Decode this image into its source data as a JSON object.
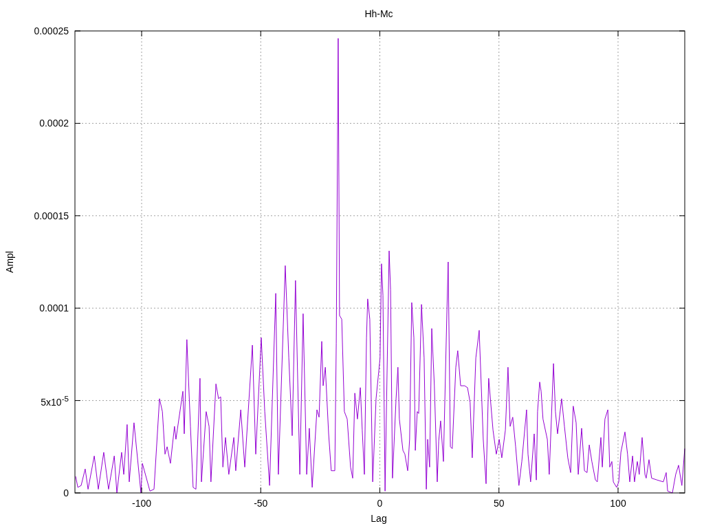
{
  "chart_data": {
    "type": "line",
    "grid": true,
    "title": "Hh-Mc",
    "xlabel": "Lag",
    "ylabel": "Ampl",
    "xlim": [
      -128,
      128
    ],
    "ylim": [
      0,
      0.00025
    ],
    "xticks": [
      -100,
      -50,
      0,
      50,
      100
    ],
    "yticks": [
      0,
      {
        "value": 5e-05,
        "label": "5x10$^{-5}$"
      },
      0.0001,
      0.00015,
      0.0002,
      0.00025
    ],
    "x": [
      -127.7,
      -126.8,
      -125.4,
      -123.7,
      -122.5,
      -119.9,
      -118.2,
      -115.9,
      -113.9,
      -111.5,
      -110.4,
      -108.4,
      -107.5,
      -106.1,
      -105.2,
      -103.2,
      -100.3,
      -99.7,
      -96.5,
      -94.8,
      -92.5,
      -91.3,
      -90.2,
      -89.3,
      -87.9,
      -86.2,
      -85.6,
      -82.7,
      -82.1,
      -81.0,
      -79.5,
      -78.4,
      -77.2,
      -75.5,
      -74.9,
      -72.9,
      -71.7,
      -70.9,
      -68.8,
      -67.7,
      -66.8,
      -65.9,
      -64.8,
      -63.4,
      -61.3,
      -60.5,
      -58.4,
      -56.7,
      -53.5,
      -52.1,
      -49.8,
      -48.3,
      -46.3,
      -43.7,
      -42.6,
      -39.7,
      -38.2,
      -36.8,
      -35.4,
      -33.6,
      -32.2,
      -30.7,
      -29.6,
      -28.4,
      -26.4,
      -25.5,
      -24.4,
      -23.8,
      -22.9,
      -21.5,
      -20.4,
      -18.9,
      -18.3,
      -17.5,
      -16.9,
      -16.0,
      -14.9,
      -13.7,
      -12.3,
      -11.4,
      -10.5,
      -9.4,
      -8.2,
      -7.4,
      -6.5,
      -5.6,
      -5.1,
      -4.2,
      -3.0,
      -1.6,
      0.1,
      0.7,
      1.3,
      2.2,
      3.9,
      4.5,
      5.3,
      6.8,
      7.6,
      8.2,
      9.7,
      10.5,
      11.7,
      12.5,
      13.4,
      14.3,
      14.9,
      15.7,
      16.3,
      17.5,
      18.6,
      19.5,
      20.1,
      20.9,
      21.8,
      22.9,
      24.1,
      24.7,
      25.5,
      26.7,
      28.1,
      28.7,
      29.6,
      30.4,
      31.9,
      32.7,
      33.9,
      35.6,
      36.8,
      37.9,
      38.8,
      40.3,
      41.7,
      43.4,
      44.6,
      45.7,
      47.5,
      48.9,
      50.1,
      51.2,
      52.7,
      53.8,
      54.7,
      55.8,
      57.0,
      58.4,
      59.6,
      61.6,
      62.2,
      63.3,
      64.8,
      65.7,
      66.2,
      67.1,
      67.7,
      68.5,
      70.3,
      71.1,
      72.9,
      73.7,
      74.6,
      76.3,
      77.5,
      78.9,
      80.1,
      81.2,
      82.4,
      83.3,
      84.7,
      85.9,
      87.0,
      87.9,
      89.0,
      90.5,
      91.3,
      92.8,
      93.4,
      94.5,
      95.7,
      96.5,
      97.4,
      98.0,
      99.4,
      100.3,
      101.2,
      102.9,
      104.0,
      104.9,
      106.1,
      106.9,
      108.1,
      108.9,
      110.1,
      111.3,
      111.8,
      113.0,
      114.1,
      116.4,
      119.0,
      120.2,
      120.8,
      122.8,
      124.2,
      125.4,
      126.8,
      128.0
    ],
    "series": [
      {
        "color": "#9400d3",
        "values": [
          9e-06,
          3e-06,
          4e-06,
          1.3e-05,
          2e-06,
          2e-05,
          2e-06,
          2.2e-05,
          2e-06,
          2e-05,
          0,
          2.2e-05,
          1e-05,
          3.7e-05,
          6e-06,
          3.8e-05,
          0,
          1.6e-05,
          1e-06,
          2e-06,
          5.1e-05,
          4.4e-05,
          2.1e-05,
          2.5e-05,
          1.6e-05,
          3.6e-05,
          2.9e-05,
          5.5e-05,
          3.2e-05,
          8.3e-05,
          3.6e-05,
          3e-06,
          2e-06,
          6.2e-05,
          6e-06,
          4.4e-05,
          3.6e-05,
          6e-06,
          5.9e-05,
          5.1e-05,
          5.2e-05,
          1.4e-05,
          3e-05,
          1e-05,
          3e-05,
          1.2e-05,
          4.5e-05,
          1.4e-05,
          8e-05,
          2.1e-05,
          8.4e-05,
          4.4e-05,
          4e-06,
          0.000108,
          1e-05,
          0.000123,
          7.3e-05,
          3.1e-05,
          0.000115,
          1e-05,
          9.7e-05,
          1e-05,
          3.5e-05,
          3e-06,
          4.5e-05,
          4.1e-05,
          8.2e-05,
          5.8e-05,
          6.8e-05,
          3.2e-05,
          1.2e-05,
          1.2e-05,
          8.1e-05,
          0.000246,
          9.6e-05,
          9.4e-05,
          4.4e-05,
          4e-05,
          1.4e-05,
          8e-06,
          5.4e-05,
          4e-05,
          5.7e-05,
          3.4e-05,
          1e-05,
          8.4e-05,
          0.000105,
          9.4e-05,
          6e-06,
          5.1e-05,
          7.3e-05,
          0.000124,
          0.000107,
          1e-06,
          0.000131,
          0.00011,
          8e-06,
          5.1e-05,
          6.8e-05,
          4e-05,
          2.3e-05,
          2.1e-05,
          1.2e-05,
          2.9e-05,
          0.000103,
          8.4e-05,
          2.3e-05,
          4.4e-05,
          4.3e-05,
          0.000102,
          7.3e-05,
          2e-06,
          2.9e-05,
          1.4e-05,
          8.9e-05,
          5.8e-05,
          6e-06,
          2.8e-05,
          3.9e-05,
          1.7e-05,
          9.6e-05,
          0.000125,
          2.5e-05,
          2.4e-05,
          6.8e-05,
          7.7e-05,
          5.8e-05,
          5.8e-05,
          5.7e-05,
          4.9e-05,
          1.9e-05,
          7.3e-05,
          8.8e-05,
          2.9e-05,
          5e-06,
          6.2e-05,
          3.4e-05,
          2.1e-05,
          2.9e-05,
          1.9e-05,
          3.4e-05,
          6.8e-05,
          3.6e-05,
          4.1e-05,
          2.5e-05,
          4e-06,
          1.7e-05,
          4.5e-05,
          2.1e-05,
          6e-06,
          3.2e-05,
          7e-06,
          4.4e-05,
          6e-05,
          5.5e-05,
          4e-05,
          2.9e-05,
          1e-05,
          7e-05,
          4.4e-05,
          3.2e-05,
          5.1e-05,
          3.6e-05,
          1.9e-05,
          1.1e-05,
          4.7e-05,
          3.8e-05,
          1e-05,
          3.5e-05,
          1.2e-05,
          1.1e-05,
          2.6e-05,
          1.7e-05,
          7e-06,
          6e-06,
          3e-05,
          1.4e-05,
          4e-05,
          4.5e-05,
          1.4e-05,
          1.7e-05,
          6e-06,
          3e-06,
          6e-06,
          2.2e-05,
          3.3e-05,
          2.1e-05,
          6e-06,
          2e-05,
          6e-06,
          1.7e-05,
          1e-05,
          3e-05,
          1e-05,
          8e-06,
          1.8e-05,
          8e-06,
          7e-06,
          6e-06,
          1.1e-05,
          1e-06,
          0,
          1e-05,
          1.5e-05,
          4e-06,
          2.4e-05
        ]
      }
    ]
  }
}
